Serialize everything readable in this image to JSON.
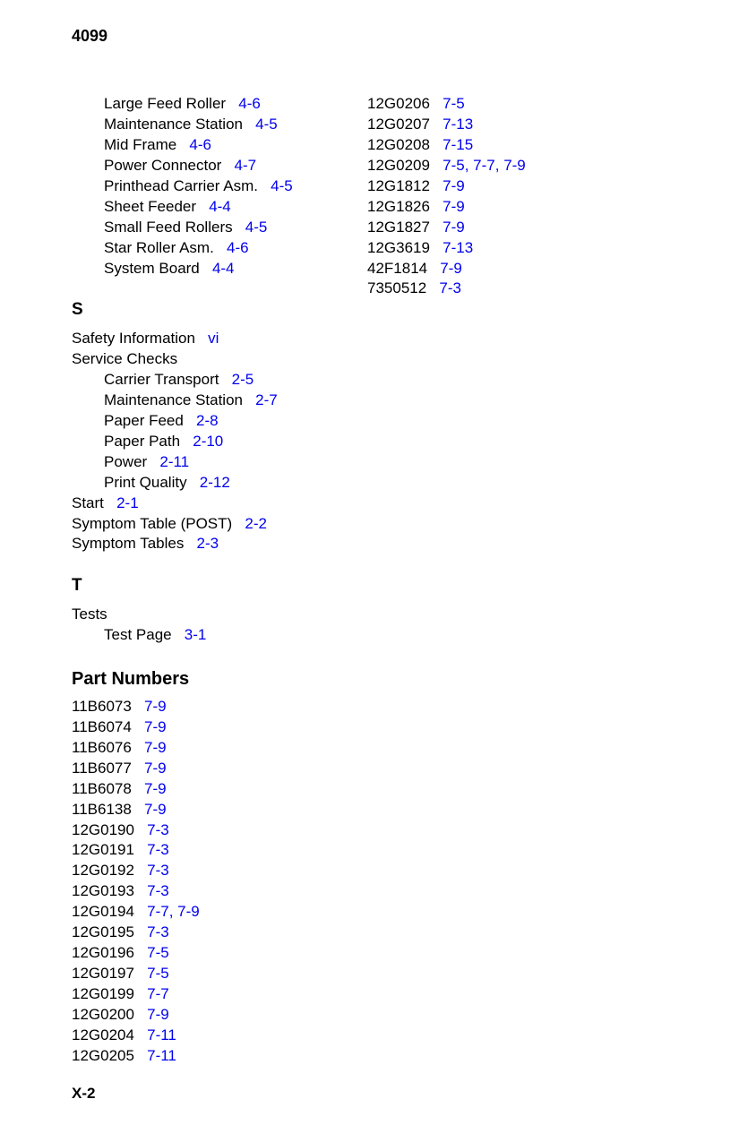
{
  "header": "4099",
  "footer": "X-2",
  "left": {
    "topItems": [
      {
        "label": "Large Feed Roller",
        "refs": [
          "4-6"
        ],
        "indent": true
      },
      {
        "label": "Maintenance Station",
        "refs": [
          "4-5"
        ],
        "indent": true
      },
      {
        "label": "Mid Frame",
        "refs": [
          "4-6"
        ],
        "indent": true
      },
      {
        "label": "Power Connector",
        "refs": [
          "4-7"
        ],
        "indent": true
      },
      {
        "label": "Printhead Carrier Asm.",
        "refs": [
          "4-5"
        ],
        "indent": true
      },
      {
        "label": "Sheet Feeder",
        "refs": [
          "4-4"
        ],
        "indent": true
      },
      {
        "label": "Small Feed Rollers",
        "refs": [
          "4-5"
        ],
        "indent": true
      },
      {
        "label": "Star Roller Asm.",
        "refs": [
          "4-6"
        ],
        "indent": true
      },
      {
        "label": "System Board",
        "refs": [
          "4-4"
        ],
        "indent": true
      }
    ],
    "sLetter": "S",
    "sItems": [
      {
        "label": "Safety Information",
        "refs": [
          "vi"
        ],
        "indent": false
      },
      {
        "label": "Service Checks",
        "refs": [],
        "indent": false
      },
      {
        "label": "Carrier Transport",
        "refs": [
          "2-5"
        ],
        "indent": true
      },
      {
        "label": "Maintenance Station",
        "refs": [
          "2-7"
        ],
        "indent": true
      },
      {
        "label": "Paper Feed",
        "refs": [
          "2-8"
        ],
        "indent": true
      },
      {
        "label": "Paper Path",
        "refs": [
          "2-10"
        ],
        "indent": true
      },
      {
        "label": "Power",
        "refs": [
          "2-11"
        ],
        "indent": true
      },
      {
        "label": "Print Quality",
        "refs": [
          "2-12"
        ],
        "indent": true
      },
      {
        "label": "Start",
        "refs": [
          "2-1"
        ],
        "indent": false
      },
      {
        "label": "Symptom Table (POST)",
        "refs": [
          "2-2"
        ],
        "indent": false
      },
      {
        "label": "Symptom Tables",
        "refs": [
          "2-3"
        ],
        "indent": false
      }
    ],
    "tLetter": "T",
    "tItems": [
      {
        "label": "Tests",
        "refs": [],
        "indent": false
      },
      {
        "label": "Test Page",
        "refs": [
          "3-1"
        ],
        "indent": true
      }
    ],
    "partHeading": "Part Numbers",
    "partItems": [
      {
        "label": "11B6073",
        "refs": [
          "7-9"
        ]
      },
      {
        "label": "11B6074",
        "refs": [
          "7-9"
        ]
      },
      {
        "label": "11B6076",
        "refs": [
          "7-9"
        ]
      },
      {
        "label": "11B6077",
        "refs": [
          "7-9"
        ]
      },
      {
        "label": "11B6078",
        "refs": [
          "7-9"
        ]
      },
      {
        "label": "11B6138",
        "refs": [
          "7-9"
        ]
      },
      {
        "label": "12G0190",
        "refs": [
          "7-3"
        ]
      },
      {
        "label": "12G0191",
        "refs": [
          "7-3"
        ]
      },
      {
        "label": "12G0192",
        "refs": [
          "7-3"
        ]
      },
      {
        "label": "12G0193",
        "refs": [
          "7-3"
        ]
      },
      {
        "label": "12G0194",
        "refs": [
          "7-7",
          "7-9"
        ]
      },
      {
        "label": "12G0195",
        "refs": [
          "7-3"
        ]
      },
      {
        "label": "12G0196",
        "refs": [
          "7-5"
        ]
      },
      {
        "label": "12G0197",
        "refs": [
          "7-5"
        ]
      },
      {
        "label": "12G0199",
        "refs": [
          "7-7"
        ]
      },
      {
        "label": "12G0200",
        "refs": [
          "7-9"
        ]
      },
      {
        "label": "12G0204",
        "refs": [
          "7-11"
        ]
      },
      {
        "label": "12G0205",
        "refs": [
          "7-11"
        ]
      }
    ]
  },
  "right": {
    "items": [
      {
        "label": "12G0206",
        "refs": [
          "7-5"
        ]
      },
      {
        "label": "12G0207",
        "refs": [
          "7-13"
        ]
      },
      {
        "label": "12G0208",
        "refs": [
          "7-15"
        ]
      },
      {
        "label": "12G0209",
        "refs": [
          "7-5",
          "7-7",
          "7-9"
        ]
      },
      {
        "label": "12G1812",
        "refs": [
          "7-9"
        ]
      },
      {
        "label": "12G1826",
        "refs": [
          "7-9"
        ]
      },
      {
        "label": "12G1827",
        "refs": [
          "7-9"
        ]
      },
      {
        "label": "12G3619",
        "refs": [
          "7-13"
        ]
      },
      {
        "label": "42F1814",
        "refs": [
          "7-9"
        ]
      },
      {
        "label": "7350512",
        "refs": [
          "7-3"
        ]
      }
    ]
  }
}
